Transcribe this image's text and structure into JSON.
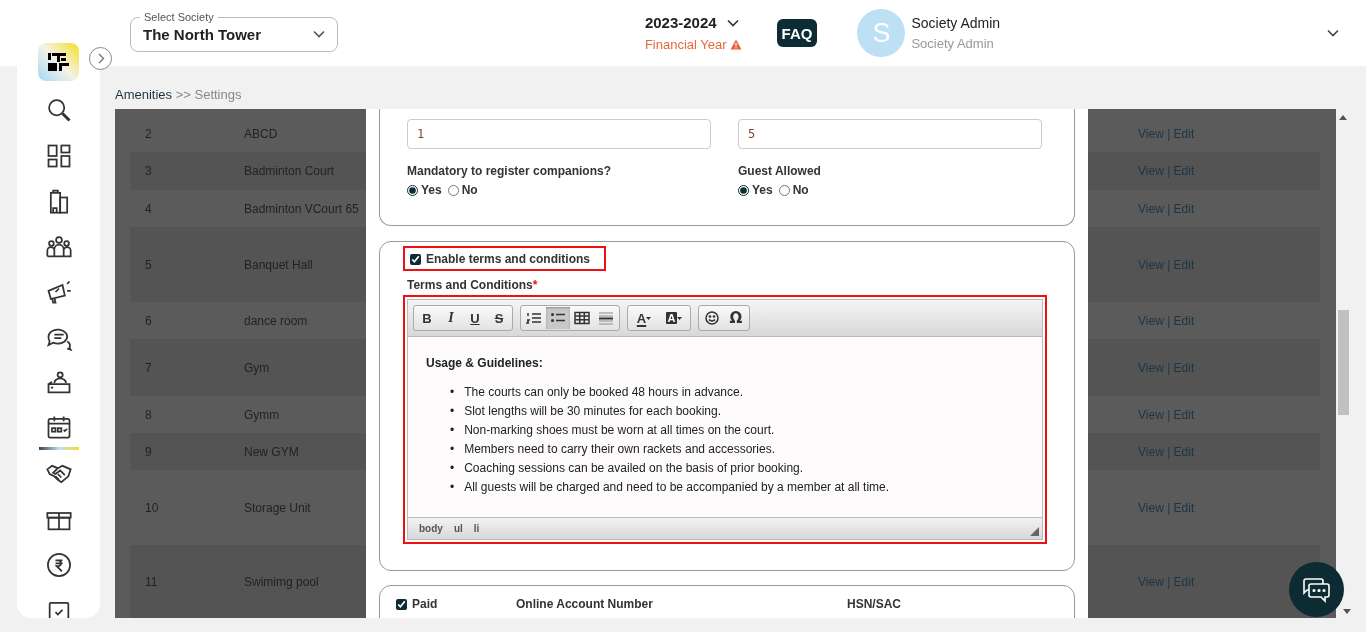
{
  "sidebar": {
    "items": [
      {
        "kind": "search",
        "selected": false
      },
      {
        "kind": "dashboard",
        "selected": false
      },
      {
        "kind": "building",
        "selected": false
      },
      {
        "kind": "people",
        "selected": false
      },
      {
        "kind": "megaphone",
        "selected": false
      },
      {
        "kind": "chat",
        "selected": false
      },
      {
        "kind": "desk",
        "selected": false
      },
      {
        "kind": "calendar",
        "selected": true
      },
      {
        "kind": "handshake",
        "selected": false
      },
      {
        "kind": "box",
        "selected": false
      },
      {
        "kind": "rupee",
        "selected": false
      },
      {
        "kind": "document",
        "selected": false
      }
    ]
  },
  "header": {
    "society_select": {
      "label": "Select Society",
      "value": "The North Tower"
    },
    "financial_year": {
      "value": "2023-2024",
      "label": "Financial Year"
    },
    "faq": "FAQ",
    "user": {
      "initial": "S",
      "name": "Society Admin",
      "role": "Society Admin",
      "expanded": false
    }
  },
  "breadcrumb": {
    "parent": "Amenities",
    "current": ">> Settings"
  },
  "table": {
    "rows": [
      {
        "number": "2",
        "name": "ABCD",
        "view": "View",
        "separator": "|",
        "edit": "Edit"
      },
      {
        "number": "3",
        "name": "Badminton Court",
        "view": "View",
        "separator": "|",
        "edit": "Edit"
      },
      {
        "number": "4",
        "name": "Badminton VCourt 65",
        "view": "View",
        "separator": "|",
        "edit": "Edit"
      },
      {
        "number": "5",
        "name": "Banquet Hall",
        "view": "View",
        "separator": "|",
        "edit": "Edit"
      },
      {
        "number": "6",
        "name": "dance room",
        "view": "View",
        "separator": "|",
        "edit": "Edit"
      },
      {
        "number": "7",
        "name": "Gym",
        "view": "View",
        "separator": "|",
        "edit": "Edit"
      },
      {
        "number": "8",
        "name": "Gymm",
        "view": "View",
        "separator": "|",
        "edit": "Edit"
      },
      {
        "number": "9",
        "name": "New GYM",
        "view": "View",
        "separator": "|",
        "edit": "Edit"
      },
      {
        "number": "10",
        "name": "Storage Unit",
        "view": "View",
        "separator": "|",
        "edit": "Edit"
      },
      {
        "number": "11",
        "name": "Swimimg pool",
        "view": "View",
        "separator": "|",
        "edit": "Edit"
      }
    ]
  },
  "modal": {
    "companions": {
      "min_value": "1",
      "max_value": "5"
    },
    "radio_groups": [
      {
        "label": "Mandatory to register companions?",
        "options": [
          {
            "label": "Yes",
            "selected": true
          },
          {
            "label": "No",
            "selected": false
          }
        ]
      },
      {
        "label": "Guest Allowed",
        "options": [
          {
            "label": "Yes",
            "selected": true
          },
          {
            "label": "No",
            "selected": false
          }
        ]
      }
    ],
    "terms": {
      "enable": {
        "label": "Enable terms and conditions",
        "checked": true
      },
      "label": "Terms and Conditions",
      "required_mark": "*",
      "toolbar": [
        [
          {
            "kind": "bold",
            "label": "B",
            "selected": false
          },
          {
            "kind": "italic",
            "label": "I",
            "selected": false
          },
          {
            "kind": "underline",
            "label": "U",
            "selected": false
          },
          {
            "kind": "strike",
            "label": "S",
            "selected": false
          }
        ],
        [
          {
            "kind": "ordered-list",
            "selected": false
          },
          {
            "kind": "bullet-list",
            "selected": true
          },
          {
            "kind": "table",
            "selected": false
          },
          {
            "kind": "rule",
            "selected": false
          }
        ],
        [
          {
            "kind": "text-color",
            "label": "A",
            "selected": false
          },
          {
            "kind": "background-color",
            "label": "A",
            "selected": false
          }
        ],
        [
          {
            "kind": "emoji",
            "selected": false
          },
          {
            "kind": "special-character",
            "label": "Ω",
            "selected": false
          }
        ]
      ],
      "content": {
        "heading": "Usage & Guidelines:",
        "items": [
          {
            "bullet": "•",
            "text": "The courts can only be booked 48 hours in advance."
          },
          {
            "bullet": "•",
            "text": "Slot lengths will be 30 minutes for each booking."
          },
          {
            "bullet": "•",
            "text": "Non-marking shoes must be worn at all times on the court."
          },
          {
            "bullet": "•",
            "text": "Members need to carry their own rackets and accessories."
          },
          {
            "bullet": "•",
            "text": "Coaching sessions can be availed on the basis of prior booking."
          },
          {
            "bullet": "•",
            "text": "All guests will be charged and need to be accompanied by a member at all time."
          }
        ]
      },
      "path": [
        "body",
        "ul",
        "li"
      ]
    },
    "payment": {
      "paid": {
        "label": "Paid",
        "checked": true
      },
      "online_account_label": "Online Account Number",
      "hsn_label": "HSN/SAC"
    }
  }
}
